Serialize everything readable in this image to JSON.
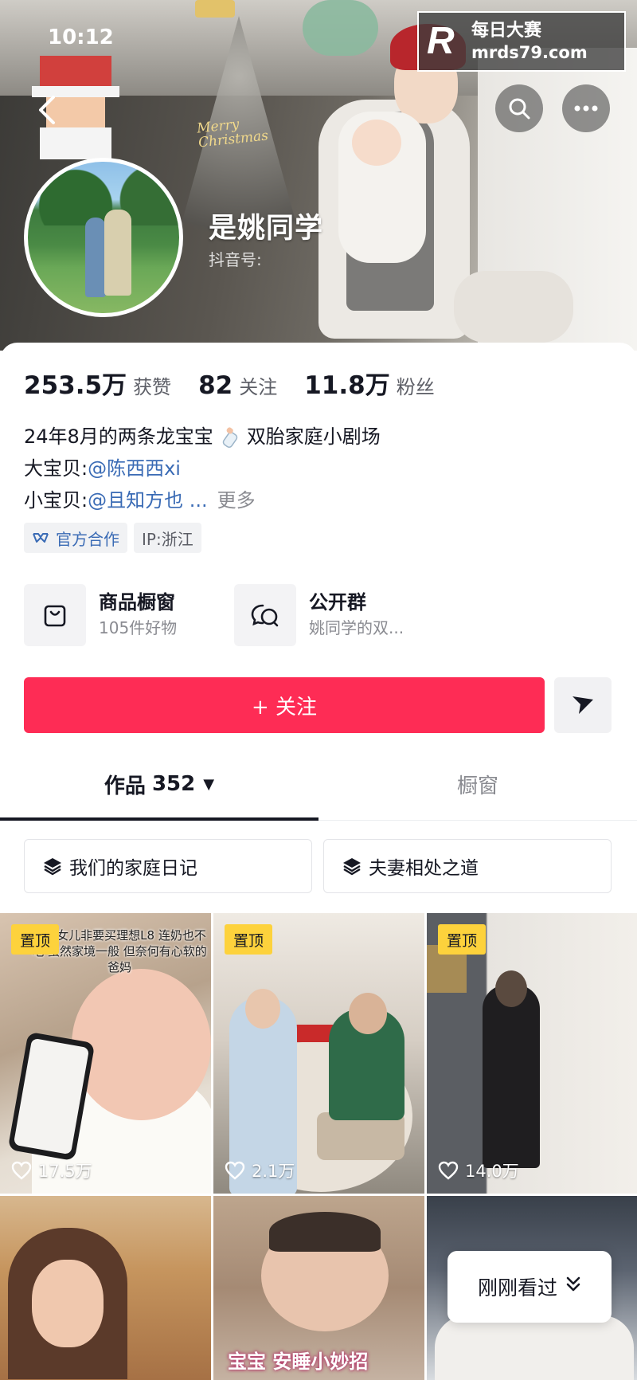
{
  "status_bar": {
    "time": "10:12"
  },
  "watermark": {
    "logo": "R",
    "line1": "每日大赛",
    "line2": "mrds79.com"
  },
  "header": {
    "merry_line1": "Merry",
    "merry_line2": "Christmas",
    "nickname": "是姚同学",
    "douyin_id_label": "抖音号:"
  },
  "stats": [
    {
      "value": "253.5万",
      "label": "获赞"
    },
    {
      "value": "82",
      "label": "关注"
    },
    {
      "value": "11.8万",
      "label": "粉丝"
    }
  ],
  "bio": {
    "line1_a": "24年8月的两条龙宝宝",
    "line1_b": "双胎家庭小剧场",
    "line2_label": "大宝贝:",
    "line2_mention": "@陈西西xi",
    "line3_label": "小宝贝:",
    "line3_mention": "@且知方也 ...",
    "more": "更多"
  },
  "tags": {
    "official": "官方合作",
    "ip": "IP:浙江"
  },
  "entries": {
    "shop_title": "商品橱窗",
    "shop_sub": "105件好物",
    "group_title": "公开群",
    "group_sub": "姚同学的双..."
  },
  "follow_button": "+ 关注",
  "tabs": {
    "works_label": "作品",
    "works_count": "352",
    "window_label": "橱窗"
  },
  "collections": [
    "我们的家庭日记",
    "夫妻相处之道"
  ],
  "videos": [
    {
      "pinned": "置顶",
      "likes": "17.5万",
      "overlay": "一个女儿非要买理想L8 连奶也不吃 虽然家境一般 但奈何有心软的爸妈"
    },
    {
      "pinned": "置顶",
      "likes": "2.1万"
    },
    {
      "pinned": "置顶",
      "likes": "14.0万"
    },
    {},
    {
      "caption": "宝宝 安睡小妙招"
    },
    {}
  ],
  "recently_viewed": "刚刚看过",
  "colors": {
    "follow": "#fe2c55",
    "pin": "#fdd23c",
    "mention": "#3a6bb5"
  }
}
